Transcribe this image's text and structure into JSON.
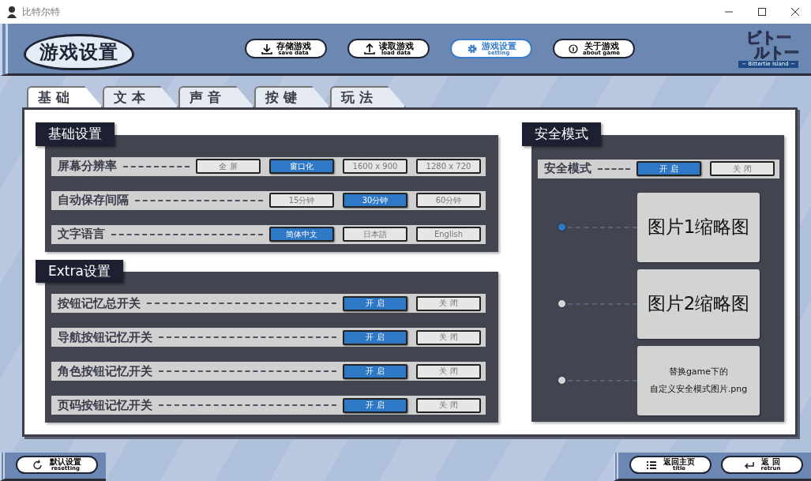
{
  "window": {
    "title": "比特尔特"
  },
  "header": {
    "title": "游戏设置",
    "nav": [
      {
        "label": "存储游戏",
        "sublabel": "save data",
        "selected": false
      },
      {
        "label": "读取游戏",
        "sublabel": "load data",
        "selected": false
      },
      {
        "label": "游戏设置",
        "sublabel": "setting",
        "selected": true
      },
      {
        "label": "关于游戏",
        "sublabel": "about game",
        "selected": false
      }
    ]
  },
  "logo": {
    "lines": [
      "ビトー",
      "ルトー"
    ],
    "tagline": "~ Bittertie Island ~"
  },
  "tabs": [
    {
      "label": "基 础",
      "selected": true
    },
    {
      "label": "文 本",
      "selected": false
    },
    {
      "label": "声 音",
      "selected": false
    },
    {
      "label": "按 键",
      "selected": false
    },
    {
      "label": "玩 法",
      "selected": false
    }
  ],
  "sections": [
    {
      "title": "基础设置",
      "rows": [
        {
          "label": "屏幕分辨率",
          "options": [
            {
              "label": "全 屏",
              "selected": false
            },
            {
              "label": "窗口化",
              "selected": true
            },
            {
              "label": "1600 x 900",
              "selected": false
            },
            {
              "label": "1280 x 720",
              "selected": false
            }
          ]
        },
        {
          "label": "自动保存间隔",
          "options": [
            {
              "label": "15分钟",
              "selected": false
            },
            {
              "label": "30分钟",
              "selected": true
            },
            {
              "label": "60分钟",
              "selected": false
            }
          ]
        },
        {
          "label": "文字语言",
          "options": [
            {
              "label": "简体中文",
              "selected": true
            },
            {
              "label": "日本語",
              "selected": false
            },
            {
              "label": "English",
              "selected": false
            }
          ]
        }
      ]
    },
    {
      "title": "Extra设置",
      "rows": [
        {
          "label": "按钮记忆总开关",
          "options": [
            {
              "label": "开 启",
              "selected": true
            },
            {
              "label": "关 闭",
              "selected": false
            }
          ]
        },
        {
          "label": "导航按钮记忆开关",
          "options": [
            {
              "label": "开 启",
              "selected": true
            },
            {
              "label": "关 闭",
              "selected": false
            }
          ]
        },
        {
          "label": "角色按钮记忆开关",
          "options": [
            {
              "label": "开 启",
              "selected": true
            },
            {
              "label": "关 闭",
              "selected": false
            }
          ]
        },
        {
          "label": "页码按钮记忆开关",
          "options": [
            {
              "label": "开 启",
              "selected": true
            },
            {
              "label": "关 闭",
              "selected": false
            }
          ]
        }
      ]
    }
  ],
  "safe_mode": {
    "title": "安全模式",
    "row": {
      "label": "安全模式",
      "options": [
        {
          "label": "开 启",
          "selected": true
        },
        {
          "label": "关 闭",
          "selected": false
        }
      ]
    },
    "images": [
      {
        "kind": "thumbnail",
        "text": "图片1缩略图",
        "selected": true
      },
      {
        "kind": "thumbnail",
        "text": "图片2缩略图",
        "selected": false
      },
      {
        "kind": "note",
        "lines": [
          "替换game下的",
          "自定义安全模式图片.png"
        ],
        "selected": false
      }
    ]
  },
  "footer": {
    "left": [
      {
        "label": "默认设置",
        "sublabel": "resetting"
      }
    ],
    "right": [
      {
        "label": "返回主页",
        "sublabel": "title"
      },
      {
        "label": "返 回",
        "sublabel": "retrun"
      }
    ]
  }
}
